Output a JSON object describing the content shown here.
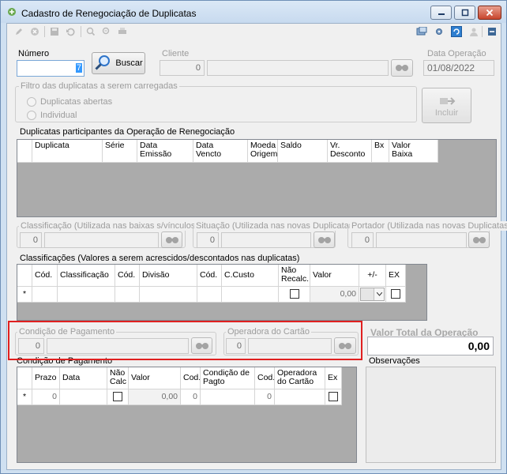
{
  "window": {
    "title": "Cadastro de Renegociação de Duplicatas"
  },
  "header": {
    "numero_label": "Número",
    "numero_value": "7",
    "buscar_label": "Buscar",
    "cliente_label": "Cliente",
    "cliente_code": "0",
    "data_operacao_label": "Data Operação",
    "data_operacao_value": "01/08/2022"
  },
  "filtro": {
    "title": "Filtro das duplicatas a serem carregadas",
    "opt1": "Duplicatas abertas",
    "opt2": "Individual",
    "incluir_label": "Incluir"
  },
  "duplicatas": {
    "title": "Duplicatas participantes da Operação de Renegociação",
    "columns": [
      "Duplicata",
      "Série",
      "Data\nEmissão",
      "Data\nVencto",
      "Moeda\nOrigem",
      "Saldo",
      "Vr.\nDesconto",
      "Bx",
      "Valor\nBaixa"
    ]
  },
  "filters_row": {
    "classificacao_label": "Classificação (Utilizada nas baixas s/vínculos)",
    "classificacao_value": "0",
    "situacao_label": "Situação (Utilizada nas novas Duplicatas)",
    "situacao_value": "0",
    "portador_label": "Portador (Utilizada nas novas Duplicatas)",
    "portador_value": "0"
  },
  "classificacoes": {
    "title": "Classificações (Valores a serem acrescidos/descontados nas duplicatas)",
    "columns": [
      "Cód.",
      "Classificação",
      "Cód.",
      "Divisão",
      "Cód.",
      "C.Custo",
      "Não\nRecalc.",
      "Valor",
      "+/-",
      "EX"
    ],
    "new_row_marker": "*",
    "new_row_valor": "0,00"
  },
  "pagamento": {
    "condicao_label": "Condição de Pagamento",
    "condicao_value": "0",
    "operadora_label": "Operadora do Cartão",
    "operadora_value": "0"
  },
  "valor_total": {
    "label": "Valor Total da Operação",
    "value": "0,00"
  },
  "condicao_grid": {
    "title": "Condição de Pagamento",
    "columns": [
      "Prazo",
      "Data",
      "Não\nCalc",
      "Valor",
      "Cod.",
      "Condição de\nPagto",
      "Cod.",
      "Operadora\ndo Cartão",
      "Ex"
    ],
    "new_row_marker": "*",
    "prazo": "0",
    "valor": "0,00",
    "cod1": "0",
    "cod2": "0"
  },
  "observacoes": {
    "label": "Observações"
  }
}
